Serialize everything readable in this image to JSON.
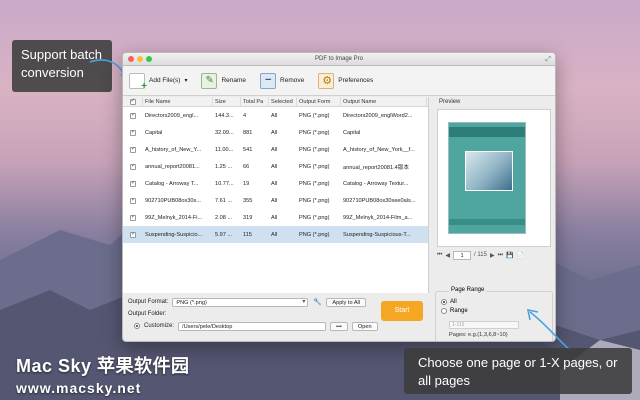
{
  "window": {
    "title": "PDF to Image Pro"
  },
  "toolbar": {
    "add_label": "Add File(s)",
    "rename_label": "Rename",
    "remove_label": "Remove",
    "preferences_label": "Preferences"
  },
  "table": {
    "headers": [
      "File Name",
      "Size",
      "Total Pa",
      "Selected",
      "Output Form",
      "Output Name"
    ],
    "rows": [
      {
        "name": "Directors2009_engl...",
        "size": "144.3...",
        "total": "4",
        "selected": "All",
        "format": "PNG (*.png)",
        "output": "Directors2009_englWord2..."
      },
      {
        "name": "Capital",
        "size": "32.09...",
        "total": "881",
        "selected": "All",
        "format": "PNG (*.png)",
        "output": "Capital"
      },
      {
        "name": "A_history_of_New_Y...",
        "size": "11.00...",
        "total": "541",
        "selected": "All",
        "format": "PNG (*.png)",
        "output": "A_history_of_New_York__f..."
      },
      {
        "name": "annual_report20081...",
        "size": "1.25 ...",
        "total": "66",
        "selected": "All",
        "format": "PNG (*.png)",
        "output": "annual_report20081.4版本"
      },
      {
        "name": "Catalog - Arroway T...",
        "size": "10.77...",
        "total": "19",
        "selected": "All",
        "format": "PNG (*.png)",
        "output": "Catalog - Arroway Textur..."
      },
      {
        "name": "902710PUB08ox30s...",
        "size": "7.61 ...",
        "total": "355",
        "selected": "All",
        "format": "PNG (*.png)",
        "output": "902710PUB08ox30see0als..."
      },
      {
        "name": "99Z_Melnyk_2014-Fi...",
        "size": "2.08 ...",
        "total": "319",
        "selected": "All",
        "format": "PNG (*.png)",
        "output": "99Z_Melnyk_2014-Film_a..."
      },
      {
        "name": "Suspending-Suspicio...",
        "size": "5.97 ...",
        "total": "115",
        "selected": "All",
        "format": "PNG (*.png)",
        "output": "Suspending-Suspicious-T..."
      }
    ]
  },
  "output": {
    "format_label": "Output Format:",
    "format_value": "PNG (*.png)",
    "apply_all": "Apply to All",
    "folder_label": "Output Folder:",
    "customize_label": "Customize:",
    "path": "/Users/pele/Desktop",
    "more": "•••",
    "open": "Open",
    "start": "Start"
  },
  "preview": {
    "label": "Preview",
    "page": "1",
    "total": "/ 115"
  },
  "page_range": {
    "title": "Page Range",
    "all": "All",
    "range": "Range",
    "range_placeholder": "1-115",
    "hint": "Pages: e.g.(1,3,6,8~10)"
  },
  "callouts": {
    "batch": "Support batch conversion",
    "page": "Choose one page or 1-X pages, or all pages"
  },
  "watermark": {
    "line1": "Mac Sky 苹果软件园",
    "line2": "www.macsky.net"
  }
}
